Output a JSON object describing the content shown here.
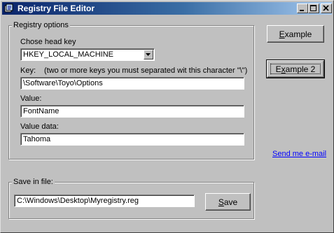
{
  "window": {
    "title": "Registry File Editor"
  },
  "registry_options": {
    "legend": "Registry options",
    "head_key_label": "Chose head key",
    "head_key_value": "HKEY_LOCAL_MACHINE",
    "key_label": "Key:",
    "key_hint": "(two or more keys you must separated wit this character \"\\\")",
    "key_value": "\\Software\\Toyo\\Options",
    "value_label": "Value:",
    "value_value": "FontName",
    "value_data_label": "Value data:",
    "value_data_value": "Tahoma"
  },
  "buttons": {
    "example_pre": "",
    "example_key": "E",
    "example_post": "xample",
    "example2_pre": "E",
    "example2_key": "x",
    "example2_post": "ample 2",
    "save_pre": "",
    "save_key": "S",
    "save_post": "ave"
  },
  "link": {
    "email": "Send me e-mail"
  },
  "save_group": {
    "legend": "Save in file:",
    "path": "C:\\Windows\\Desktop\\Myregistry.reg"
  },
  "colors": {
    "face": "#c0c0c0",
    "title_start": "#0a246a",
    "title_end": "#a6caf0",
    "link": "#0000ff"
  }
}
